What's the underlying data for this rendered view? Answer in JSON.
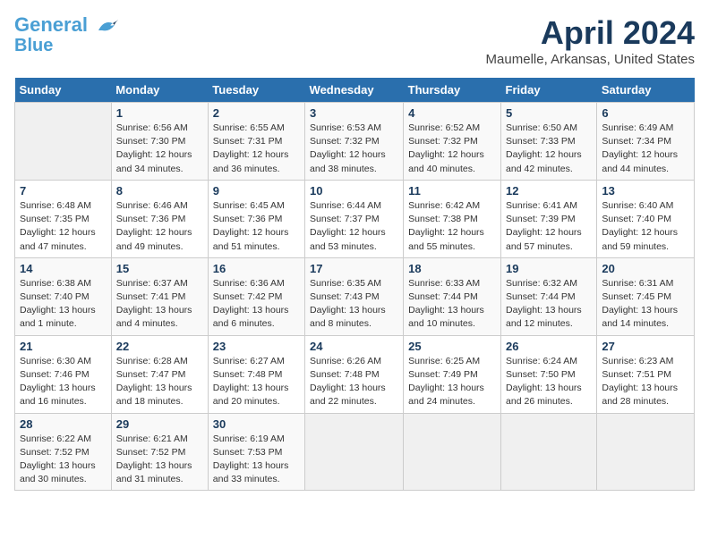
{
  "header": {
    "logo_line1": "General",
    "logo_line2": "Blue",
    "title": "April 2024",
    "subtitle": "Maumelle, Arkansas, United States"
  },
  "calendar": {
    "days_of_week": [
      "Sunday",
      "Monday",
      "Tuesday",
      "Wednesday",
      "Thursday",
      "Friday",
      "Saturday"
    ],
    "weeks": [
      [
        {
          "day": "",
          "sunrise": "",
          "sunset": "",
          "daylight": ""
        },
        {
          "day": "1",
          "sunrise": "Sunrise: 6:56 AM",
          "sunset": "Sunset: 7:30 PM",
          "daylight": "Daylight: 12 hours and 34 minutes."
        },
        {
          "day": "2",
          "sunrise": "Sunrise: 6:55 AM",
          "sunset": "Sunset: 7:31 PM",
          "daylight": "Daylight: 12 hours and 36 minutes."
        },
        {
          "day": "3",
          "sunrise": "Sunrise: 6:53 AM",
          "sunset": "Sunset: 7:32 PM",
          "daylight": "Daylight: 12 hours and 38 minutes."
        },
        {
          "day": "4",
          "sunrise": "Sunrise: 6:52 AM",
          "sunset": "Sunset: 7:32 PM",
          "daylight": "Daylight: 12 hours and 40 minutes."
        },
        {
          "day": "5",
          "sunrise": "Sunrise: 6:50 AM",
          "sunset": "Sunset: 7:33 PM",
          "daylight": "Daylight: 12 hours and 42 minutes."
        },
        {
          "day": "6",
          "sunrise": "Sunrise: 6:49 AM",
          "sunset": "Sunset: 7:34 PM",
          "daylight": "Daylight: 12 hours and 44 minutes."
        }
      ],
      [
        {
          "day": "7",
          "sunrise": "Sunrise: 6:48 AM",
          "sunset": "Sunset: 7:35 PM",
          "daylight": "Daylight: 12 hours and 47 minutes."
        },
        {
          "day": "8",
          "sunrise": "Sunrise: 6:46 AM",
          "sunset": "Sunset: 7:36 PM",
          "daylight": "Daylight: 12 hours and 49 minutes."
        },
        {
          "day": "9",
          "sunrise": "Sunrise: 6:45 AM",
          "sunset": "Sunset: 7:36 PM",
          "daylight": "Daylight: 12 hours and 51 minutes."
        },
        {
          "day": "10",
          "sunrise": "Sunrise: 6:44 AM",
          "sunset": "Sunset: 7:37 PM",
          "daylight": "Daylight: 12 hours and 53 minutes."
        },
        {
          "day": "11",
          "sunrise": "Sunrise: 6:42 AM",
          "sunset": "Sunset: 7:38 PM",
          "daylight": "Daylight: 12 hours and 55 minutes."
        },
        {
          "day": "12",
          "sunrise": "Sunrise: 6:41 AM",
          "sunset": "Sunset: 7:39 PM",
          "daylight": "Daylight: 12 hours and 57 minutes."
        },
        {
          "day": "13",
          "sunrise": "Sunrise: 6:40 AM",
          "sunset": "Sunset: 7:40 PM",
          "daylight": "Daylight: 12 hours and 59 minutes."
        }
      ],
      [
        {
          "day": "14",
          "sunrise": "Sunrise: 6:38 AM",
          "sunset": "Sunset: 7:40 PM",
          "daylight": "Daylight: 13 hours and 1 minute."
        },
        {
          "day": "15",
          "sunrise": "Sunrise: 6:37 AM",
          "sunset": "Sunset: 7:41 PM",
          "daylight": "Daylight: 13 hours and 4 minutes."
        },
        {
          "day": "16",
          "sunrise": "Sunrise: 6:36 AM",
          "sunset": "Sunset: 7:42 PM",
          "daylight": "Daylight: 13 hours and 6 minutes."
        },
        {
          "day": "17",
          "sunrise": "Sunrise: 6:35 AM",
          "sunset": "Sunset: 7:43 PM",
          "daylight": "Daylight: 13 hours and 8 minutes."
        },
        {
          "day": "18",
          "sunrise": "Sunrise: 6:33 AM",
          "sunset": "Sunset: 7:44 PM",
          "daylight": "Daylight: 13 hours and 10 minutes."
        },
        {
          "day": "19",
          "sunrise": "Sunrise: 6:32 AM",
          "sunset": "Sunset: 7:44 PM",
          "daylight": "Daylight: 13 hours and 12 minutes."
        },
        {
          "day": "20",
          "sunrise": "Sunrise: 6:31 AM",
          "sunset": "Sunset: 7:45 PM",
          "daylight": "Daylight: 13 hours and 14 minutes."
        }
      ],
      [
        {
          "day": "21",
          "sunrise": "Sunrise: 6:30 AM",
          "sunset": "Sunset: 7:46 PM",
          "daylight": "Daylight: 13 hours and 16 minutes."
        },
        {
          "day": "22",
          "sunrise": "Sunrise: 6:28 AM",
          "sunset": "Sunset: 7:47 PM",
          "daylight": "Daylight: 13 hours and 18 minutes."
        },
        {
          "day": "23",
          "sunrise": "Sunrise: 6:27 AM",
          "sunset": "Sunset: 7:48 PM",
          "daylight": "Daylight: 13 hours and 20 minutes."
        },
        {
          "day": "24",
          "sunrise": "Sunrise: 6:26 AM",
          "sunset": "Sunset: 7:48 PM",
          "daylight": "Daylight: 13 hours and 22 minutes."
        },
        {
          "day": "25",
          "sunrise": "Sunrise: 6:25 AM",
          "sunset": "Sunset: 7:49 PM",
          "daylight": "Daylight: 13 hours and 24 minutes."
        },
        {
          "day": "26",
          "sunrise": "Sunrise: 6:24 AM",
          "sunset": "Sunset: 7:50 PM",
          "daylight": "Daylight: 13 hours and 26 minutes."
        },
        {
          "day": "27",
          "sunrise": "Sunrise: 6:23 AM",
          "sunset": "Sunset: 7:51 PM",
          "daylight": "Daylight: 13 hours and 28 minutes."
        }
      ],
      [
        {
          "day": "28",
          "sunrise": "Sunrise: 6:22 AM",
          "sunset": "Sunset: 7:52 PM",
          "daylight": "Daylight: 13 hours and 30 minutes."
        },
        {
          "day": "29",
          "sunrise": "Sunrise: 6:21 AM",
          "sunset": "Sunset: 7:52 PM",
          "daylight": "Daylight: 13 hours and 31 minutes."
        },
        {
          "day": "30",
          "sunrise": "Sunrise: 6:19 AM",
          "sunset": "Sunset: 7:53 PM",
          "daylight": "Daylight: 13 hours and 33 minutes."
        },
        {
          "day": "",
          "sunrise": "",
          "sunset": "",
          "daylight": ""
        },
        {
          "day": "",
          "sunrise": "",
          "sunset": "",
          "daylight": ""
        },
        {
          "day": "",
          "sunrise": "",
          "sunset": "",
          "daylight": ""
        },
        {
          "day": "",
          "sunrise": "",
          "sunset": "",
          "daylight": ""
        }
      ]
    ]
  }
}
